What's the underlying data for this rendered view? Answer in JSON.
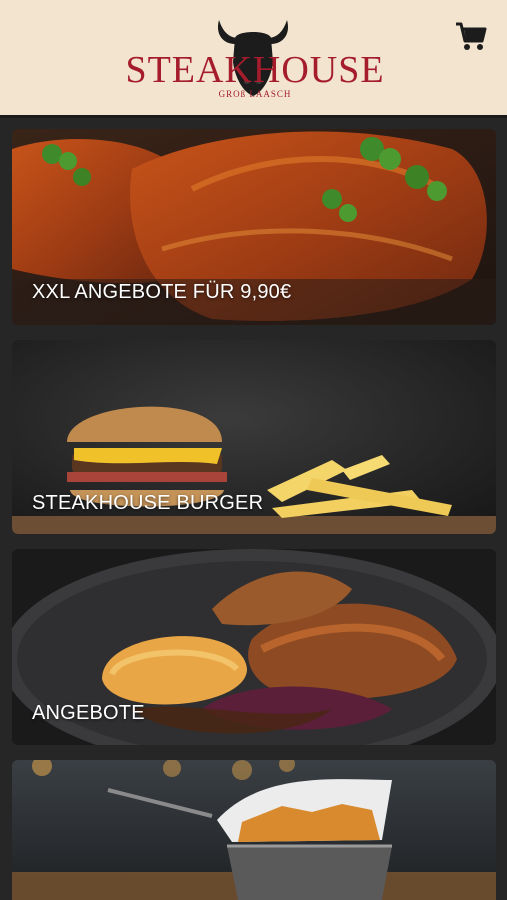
{
  "header": {
    "brand": "STEAKHOUSE",
    "brand_sub": "GROß LAASCH",
    "logo_icon": "bull-head-icon",
    "cart_icon": "shopping-cart-icon"
  },
  "categories": [
    {
      "label": "XXL ANGEBOTE FÜR 9,90€",
      "image": "bbq-ribs"
    },
    {
      "label": "STEAKHOUSE BURGER",
      "image": "burger-and-fries"
    },
    {
      "label": "ANGEBOTE",
      "image": "roast-duck-with-red-cabbage"
    },
    {
      "label": "",
      "image": "fries-in-basket"
    }
  ],
  "colors": {
    "header_bg": "#f2e4cf",
    "brand_red": "#a51d2d",
    "page_bg": "#262626"
  }
}
